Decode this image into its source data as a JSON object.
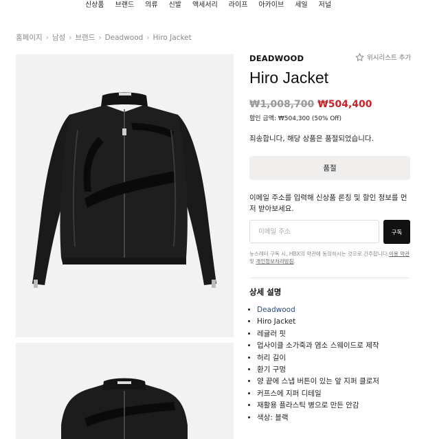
{
  "nav": {
    "items": [
      "신상품",
      "브랜드",
      "의류",
      "신발",
      "액세서리",
      "라이프",
      "아카이브",
      "세일",
      "저널"
    ]
  },
  "breadcrumb": [
    "홈페이지",
    "남성",
    "브랜드",
    "Deadwood",
    "Hiro Jacket"
  ],
  "product": {
    "brand": "DEADWOOD",
    "wishlist_label": "위시리스트 추가",
    "title": "Hiro Jacket",
    "original_price": "₩1,008,700",
    "sale_price": "₩504,400",
    "discount_text": "할인 금액: ₩504,300 (50% Off)",
    "soldout_message": "죄송합니다, 해당 상품은 품절되었습니다.",
    "soldout_button": "품절"
  },
  "newsletter": {
    "text": "이메일 주소를 입력해 신상품 론칭 및 할인 정보를 먼저 받아보세요.",
    "placeholder": "이메일 주소",
    "button": "구독",
    "consent_prefix": "뉴스레터 구독 시, HBX의 약관에 동의하시는 것으로 간주합니다.",
    "terms_link": "이용 약관",
    "consent_and": " 및 ",
    "privacy_link": "개인정보처리방침",
    "consent_suffix": "."
  },
  "details": {
    "title": "상세 설명",
    "brand_link": "Deadwood",
    "items": [
      "Hiro Jacket",
      "레귤러 핏",
      "업사이클 소가죽과 염소 스웨이드로 제작",
      "허리 길이",
      "환기 구멍",
      "양 끝에 스냅 버튼이 있는 앞 지퍼 클로저",
      "커프스에 지퍼 디테일",
      "재활용 플라스틱 병으로 만든 안감",
      "색상: 블랙"
    ]
  },
  "colors": {
    "sale": "#c4242b",
    "button_dark": "#111111",
    "soldout_bg": "#f0efed",
    "link": "#2a4e7e"
  }
}
